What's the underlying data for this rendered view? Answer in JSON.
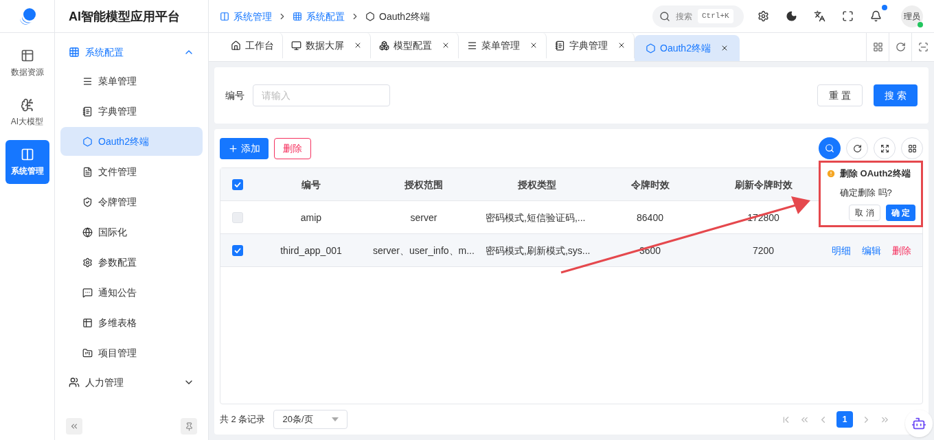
{
  "app": {
    "title": "AI智能模型应用平台"
  },
  "rail": [
    {
      "label": "数据资源",
      "selected": false,
      "kind": "table"
    },
    {
      "label": "AI大模型",
      "selected": false,
      "kind": "ai"
    },
    {
      "label": "系统管理",
      "selected": true,
      "kind": "system"
    }
  ],
  "sidebar": {
    "group": {
      "label": "系统配置",
      "expanded": true
    },
    "items": [
      {
        "label": "菜单管理",
        "selected": false,
        "kind": "menu"
      },
      {
        "label": "字典管理",
        "selected": false,
        "kind": "book"
      },
      {
        "label": "Oauth2终端",
        "selected": true,
        "kind": "hex"
      },
      {
        "label": "文件管理",
        "selected": false,
        "kind": "file"
      },
      {
        "label": "令牌管理",
        "selected": false,
        "kind": "token"
      },
      {
        "label": "国际化",
        "selected": false,
        "kind": "globe"
      },
      {
        "label": "参数配置",
        "selected": false,
        "kind": "gear"
      },
      {
        "label": "通知公告",
        "selected": false,
        "kind": "chat"
      },
      {
        "label": "多维表格",
        "selected": false,
        "kind": "table"
      },
      {
        "label": "项目管理",
        "selected": false,
        "kind": "project"
      }
    ],
    "other_group": {
      "label": "人力管理",
      "expanded": false
    }
  },
  "breadcrumb": [
    {
      "label": "系统管理",
      "kind": "system"
    },
    {
      "label": "系统配置",
      "kind": "grid"
    },
    {
      "label": "Oauth2终端",
      "kind": "hex"
    }
  ],
  "header": {
    "search": {
      "placeholder": "搜索",
      "shortcut": "Ctrl+K"
    },
    "notification_dot": true,
    "avatar": "理员",
    "online": true
  },
  "tabs": [
    {
      "label": "工作台",
      "selected": false,
      "closable": false,
      "kind": "home"
    },
    {
      "label": "数据大屏",
      "selected": false,
      "closable": true,
      "kind": "monitor"
    },
    {
      "label": "模型配置",
      "selected": false,
      "closable": true,
      "kind": "model"
    },
    {
      "label": "菜单管理",
      "selected": false,
      "closable": true,
      "kind": "menu"
    },
    {
      "label": "字典管理",
      "selected": false,
      "closable": true,
      "kind": "book"
    },
    {
      "label": "Oauth2终端",
      "selected": true,
      "closable": true,
      "kind": "hex"
    }
  ],
  "filter": {
    "label": "编号",
    "placeholder": "请输入",
    "reset": "重 置",
    "search": "搜 索"
  },
  "toolbar": {
    "add": "添加",
    "delete": "删除"
  },
  "table": {
    "select_all_checked": true,
    "columns": [
      "编号",
      "授权范围",
      "授权类型",
      "令牌时效",
      "刷新令牌时效"
    ],
    "rows": [
      {
        "checked": false,
        "cells": [
          "amip",
          "server",
          "密码模式,短信验证码,...",
          "86400",
          "172800"
        ],
        "actions": []
      },
      {
        "checked": true,
        "cells": [
          "third_app_001",
          "server、user_info、m...",
          "密码模式,刷新模式,sys...",
          "3600",
          "7200"
        ],
        "actions": [
          {
            "label": "明细",
            "kind": "normal"
          },
          {
            "label": "编辑",
            "kind": "normal"
          },
          {
            "label": "删除",
            "kind": "danger"
          }
        ]
      }
    ]
  },
  "popconfirm": {
    "title": "删除 OAuth2终端",
    "message": "确定删除 吗?",
    "cancel": "取 消",
    "confirm": "确 定"
  },
  "pagination": {
    "total": "共 2 条记录",
    "page_size": "20条/页",
    "pages": [
      {
        "label": "1",
        "selected": true
      }
    ]
  }
}
